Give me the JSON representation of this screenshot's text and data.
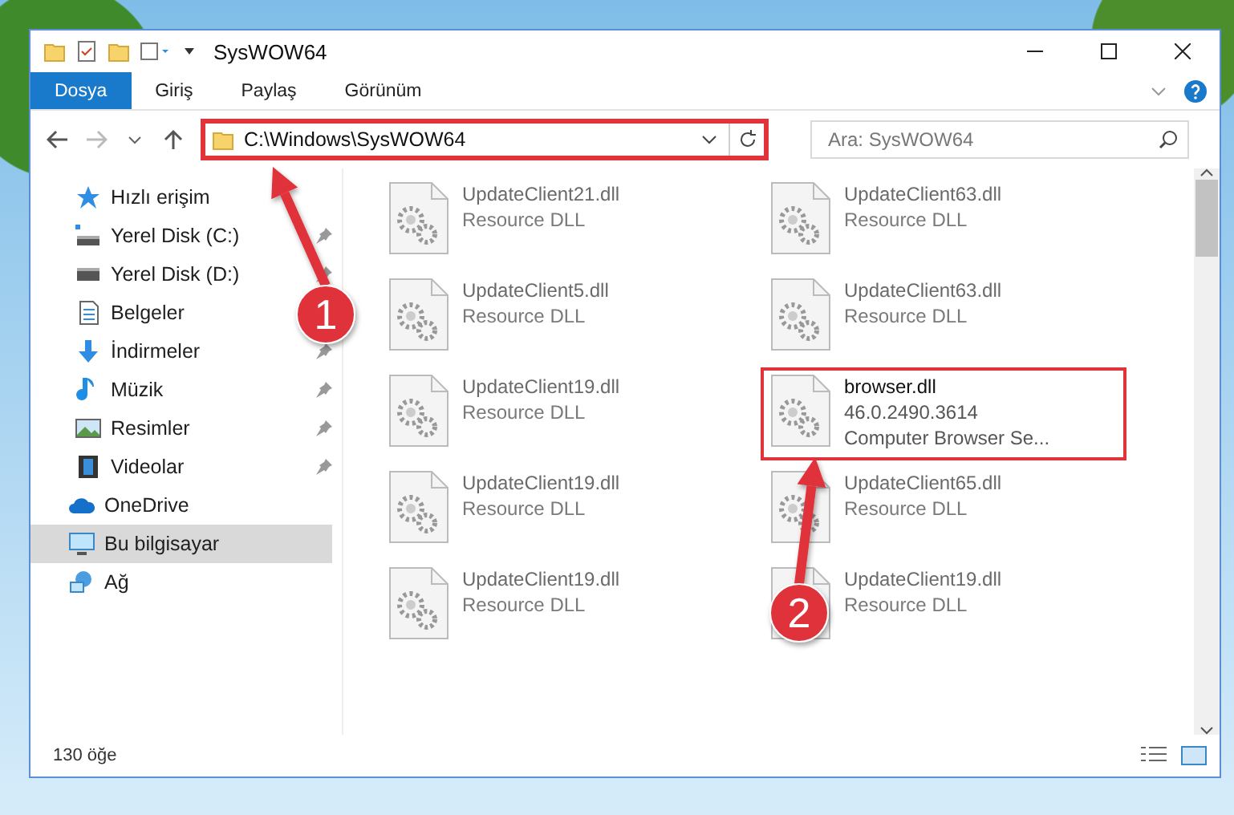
{
  "window": {
    "title": "SysWOW64"
  },
  "ribbon_tabs": [
    {
      "label": "Dosya",
      "selected": true
    },
    {
      "label": "Giriş",
      "selected": false
    },
    {
      "label": "Paylaş",
      "selected": false
    },
    {
      "label": "Görünüm",
      "selected": false
    }
  ],
  "address": {
    "value": "C:\\Windows\\SysWOW64",
    "highlighted": true
  },
  "search": {
    "placeholder": "Ara: SysWOW64"
  },
  "sidebar": {
    "items": [
      {
        "label": "Hızlı erişim",
        "kind": "star",
        "selected": false,
        "children": [
          {
            "label": "Yerel Disk (C:)",
            "kind": "drive-c",
            "pinned": true,
            "selected": false
          },
          {
            "label": "Yerel Disk (D:)",
            "kind": "drive",
            "pinned": true,
            "selected": false
          },
          {
            "label": "Belgeler",
            "kind": "docs",
            "selected": false
          },
          {
            "label": "İndirmeler",
            "kind": "download",
            "pinned": true,
            "selected": false
          },
          {
            "label": "Müzik",
            "kind": "music",
            "pinned": true,
            "selected": false
          },
          {
            "label": "Resimler",
            "kind": "pictures",
            "pinned": true,
            "selected": false
          },
          {
            "label": "Videolar",
            "kind": "videos",
            "pinned": true,
            "selected": false
          }
        ]
      },
      {
        "label": "OneDrive",
        "kind": "cloud",
        "selected": false
      },
      {
        "label": "Bu bilgisayar",
        "kind": "pc",
        "selected": true
      },
      {
        "label": "Ağ",
        "kind": "network",
        "selected": false
      }
    ]
  },
  "files": [
    {
      "name": "UpdateClient21.dll",
      "details": [
        "Resource DLL"
      ],
      "blurred": true,
      "highlighted": false
    },
    {
      "name": "UpdateClient63.dll",
      "details": [
        "Resource DLL"
      ],
      "blurred": true,
      "highlighted": false
    },
    {
      "name": "UpdateClient5.dll",
      "details": [
        "Resource DLL"
      ],
      "blurred": true,
      "highlighted": false
    },
    {
      "name": "UpdateClient63.dll",
      "details": [
        "Resource DLL"
      ],
      "blurred": true,
      "highlighted": false
    },
    {
      "name": "UpdateClient19.dll",
      "details": [
        "Resource DLL"
      ],
      "blurred": true,
      "highlighted": false
    },
    {
      "name": "browser.dll",
      "details": [
        "46.0.2490.3614",
        "Computer Browser Se..."
      ],
      "blurred": false,
      "highlighted": true
    },
    {
      "name": "UpdateClient19.dll",
      "details": [
        "Resource DLL"
      ],
      "blurred": true,
      "highlighted": false
    },
    {
      "name": "UpdateClient65.dll",
      "details": [
        "Resource DLL"
      ],
      "blurred": true,
      "highlighted": false
    },
    {
      "name": "UpdateClient19.dll",
      "details": [
        "Resource DLL"
      ],
      "blurred": true,
      "highlighted": false
    },
    {
      "name": "UpdateClient19.dll",
      "details": [
        "Resource DLL"
      ],
      "blurred": true,
      "highlighted": false
    }
  ],
  "status_bar": {
    "count": "130 öğe"
  },
  "annotations": [
    {
      "number": "1"
    },
    {
      "number": "2"
    }
  ]
}
